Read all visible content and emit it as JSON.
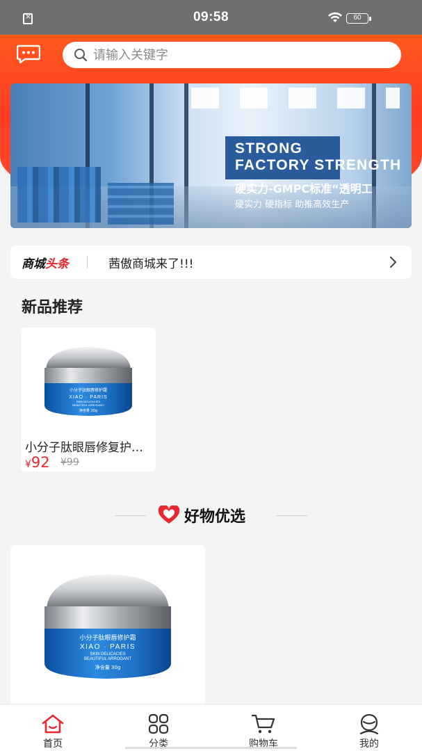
{
  "status_bar": {
    "time": "09:58",
    "battery": "60"
  },
  "header": {
    "search_placeholder": "请输入关键字"
  },
  "banner": {
    "line1": "STRONG",
    "line2": "FACTORY STRENGTH",
    "line3": "硬实力-GMPC标准“透明工",
    "line4": "硬实力  硬指标  助推高效生产"
  },
  "news": {
    "logo_part1": "商城",
    "logo_part2": "头条",
    "text": "茜傲商城来了!!!"
  },
  "new_products": {
    "title": "新品推荐",
    "items": [
      {
        "name": "小分子肽眼唇修复护理霜",
        "price_symbol": "¥",
        "price": "92",
        "old_price": "¥99"
      }
    ]
  },
  "good_picks": {
    "title": "好物优选"
  },
  "product_label": {
    "top": "小分子肽眼唇修护霜",
    "brand": "XIAO · PARIS",
    "sub1": "SKIN DELICACIES",
    "sub2": "BEAUTIFUL ARROGANT",
    "net": "净含量 30g"
  },
  "tabs": [
    {
      "label": "首页",
      "icon": "home-icon"
    },
    {
      "label": "分类",
      "icon": "grid-icon"
    },
    {
      "label": "购物车",
      "icon": "cart-icon"
    },
    {
      "label": "我的",
      "icon": "user-icon"
    }
  ],
  "colors": {
    "accent": "#e8272f",
    "header": "#ff4a24"
  }
}
